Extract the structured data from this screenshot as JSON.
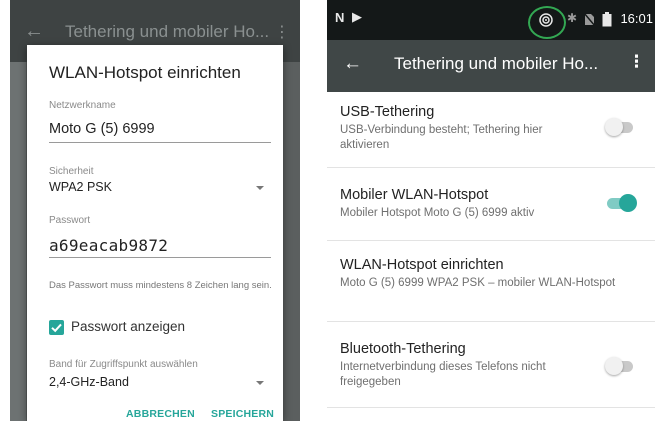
{
  "left": {
    "appbar": {
      "title": "Tethering und mobiler Ho..."
    },
    "dialog": {
      "title": "WLAN-Hotspot einrichten",
      "network_name_label": "Netzwerkname",
      "network_name_value": "Moto G (5) 6999",
      "security_label": "Sicherheit",
      "security_value": "WPA2 PSK",
      "password_label": "Passwort",
      "password_value": "a69eacab9872",
      "password_hint": "Das Passwort muss mindestens 8 Zeichen lang sein.",
      "show_password_label": "Passwort anzeigen",
      "show_password_checked": true,
      "band_label": "Band für Zugriffspunkt auswählen",
      "band_value": "2,4-GHz-Band",
      "cancel_label": "ABBRECHEN",
      "save_label": "SPEICHERN"
    }
  },
  "right": {
    "status_bar": {
      "time": "16:01",
      "icons": [
        "n-icon",
        "play-flag-icon",
        "hotspot-icon",
        "bluetooth-icon",
        "no-sim-icon",
        "battery-icon"
      ]
    },
    "appbar": {
      "title": "Tethering und mobiler Ho..."
    },
    "items": [
      {
        "title": "USB-Tethering",
        "subtitle": "USB-Verbindung besteht; Tethering hier aktivieren",
        "toggle": false
      },
      {
        "title": "Mobiler WLAN-Hotspot",
        "subtitle": "Mobiler Hotspot Moto G (5) 6999 aktiv",
        "toggle": true
      },
      {
        "title": "WLAN-Hotspot einrichten",
        "subtitle": "Moto G (5) 6999 WPA2 PSK – mobiler WLAN-Hotspot"
      },
      {
        "title": "Bluetooth-Tethering",
        "subtitle": "Internetverbindung dieses Telefons nicht freigegeben",
        "toggle": false
      }
    ],
    "accent": "#26a69a",
    "highlight_ring": "#33a853"
  }
}
